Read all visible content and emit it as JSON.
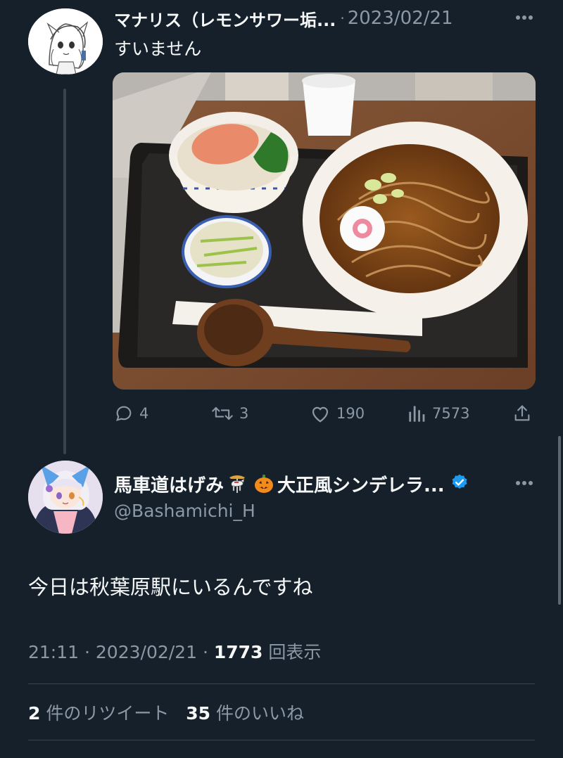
{
  "parent_tweet": {
    "display_name": "マナリス（レモンサワー垢...",
    "separator": "·",
    "date": "2023/02/21",
    "text": "すいません",
    "more_icon": "ellipsis-icon",
    "actions": {
      "replies": "4",
      "retweets": "3",
      "likes": "190",
      "views": "7573"
    }
  },
  "main_tweet": {
    "display_name": "馬車道はげみ",
    "display_name_suffix": "大正風シンデレラ...",
    "emojis": [
      "carousel-horse-icon",
      "jack-o-lantern-icon"
    ],
    "handle": "@Bashamichi_H",
    "text": "今日は秋葉原駅にいるんですね",
    "time": "21:11",
    "separator": "·",
    "date": "2023/02/21",
    "views_count": "1773",
    "views_label": "回表示",
    "retweet_count": "2",
    "retweet_label": "件のリツイート",
    "like_count": "35",
    "like_label": "件のいいね"
  },
  "colors": {
    "background": "#15202b",
    "text_primary": "#f7f9f9",
    "text_secondary": "#8b98a5",
    "divider": "#38444d",
    "verified": "#1d9bf0"
  }
}
